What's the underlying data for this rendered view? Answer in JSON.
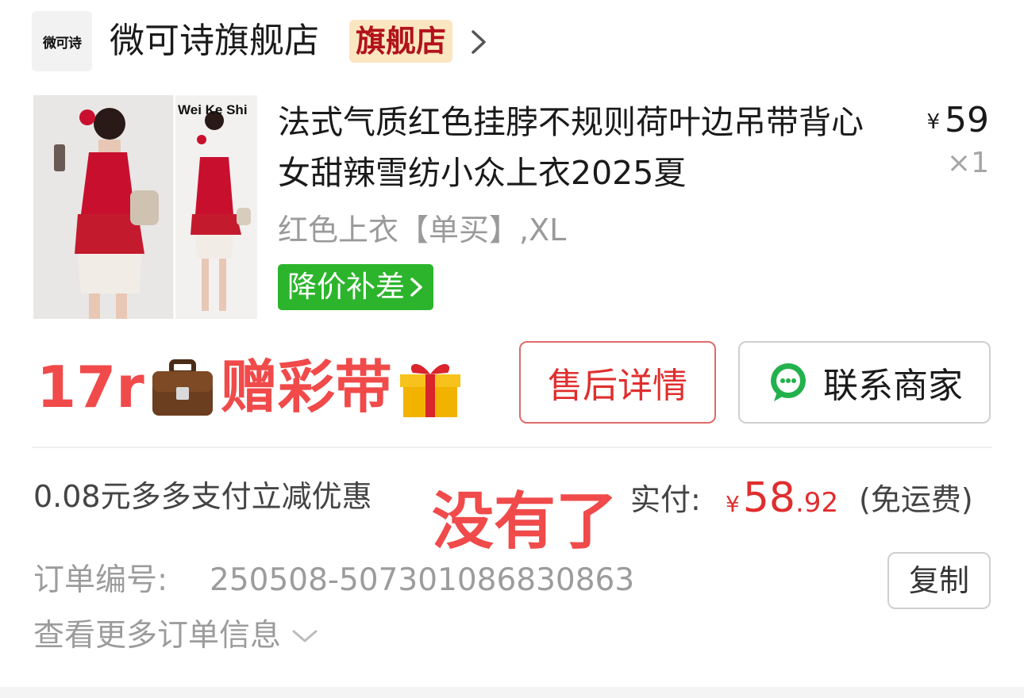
{
  "store": {
    "logo_text": "微可诗",
    "name": "微可诗旗舰店",
    "badge": "旗舰店"
  },
  "product": {
    "image_watermark": "Wei Ke Shi",
    "title": "法式气质红色挂脖不规则荷叶边吊带背心女甜辣雪纺小众上衣2025夏",
    "price_symbol": "¥",
    "price": "59",
    "quantity": "×1",
    "spec": "红色上衣【单买】,XL",
    "price_protection_label": "降价补差"
  },
  "overlay": {
    "note_prefix": "17r",
    "note_suffix": "赠彩带",
    "sold_out": "没有了"
  },
  "actions": {
    "after_sale_label": "售后详情",
    "contact_label": "联系商家"
  },
  "payment": {
    "discount_text": "0.08元多多支付立减优惠",
    "paid_label": "实付:",
    "currency": "¥",
    "amount_int": "58",
    "amount_dec": ".92",
    "shipping_note": "(免运费)"
  },
  "order": {
    "number_label": "订单编号:",
    "number": "250508-507301086830863",
    "copy_label": "复制",
    "more_info_label": "查看更多订单信息"
  },
  "colors": {
    "accent_red": "#e02e2e",
    "badge_bg": "#fbe6c2",
    "price_protect_green": "#2cb52c",
    "overlay_red": "#f04a4a"
  },
  "icons": [
    "chevron-right-icon",
    "briefcase-emoji-icon",
    "gift-emoji-icon",
    "chat-bubble-icon",
    "chevron-down-icon"
  ]
}
